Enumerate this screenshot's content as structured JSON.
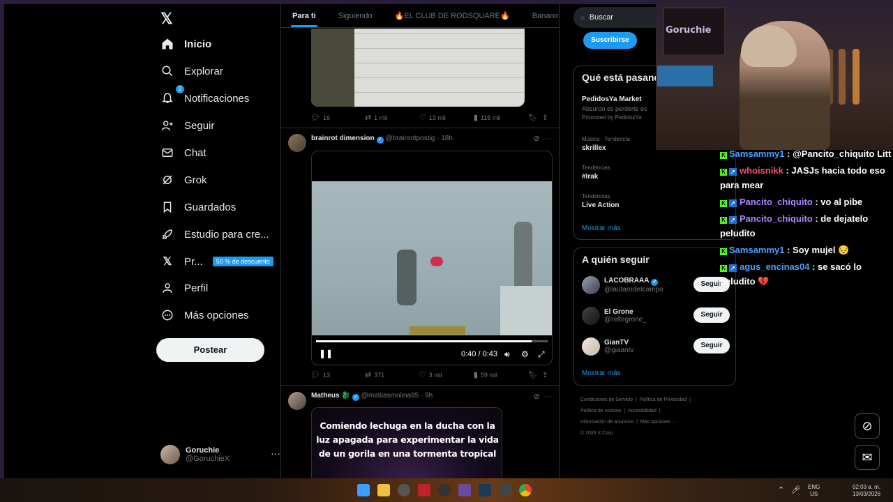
{
  "nav": {
    "items": [
      {
        "label": "Inicio",
        "icon": "home-icon"
      },
      {
        "label": "Explorar",
        "icon": "search-icon"
      },
      {
        "label": "Notificaciones",
        "icon": "bell-icon",
        "badge": "2"
      },
      {
        "label": "Seguir",
        "icon": "add-user-icon"
      },
      {
        "label": "Chat",
        "icon": "mail-icon"
      },
      {
        "label": "Grok",
        "icon": "grok-icon"
      },
      {
        "label": "Guardados",
        "icon": "bookmark-icon"
      },
      {
        "label": "Estudio para cre...",
        "icon": "rocket-icon"
      },
      {
        "label": "Pr...",
        "icon": "x-icon",
        "promo": "50 % de descuento"
      },
      {
        "label": "Perfil",
        "icon": "person-icon"
      },
      {
        "label": "Más opciones",
        "icon": "more-circle-icon"
      }
    ],
    "post_button": "Postear",
    "account": {
      "name": "Goruchie",
      "handle": "@GoruchieX",
      "more": "···"
    }
  },
  "tabs": [
    "Para ti",
    "Siguiendo",
    "🔥EL CLUB DE RODSQUARE🔥",
    "Bananirou"
  ],
  "feed": {
    "post1_actions": {
      "replies": "16",
      "reposts": "1 mil",
      "likes": "13 mil",
      "views": "115 mil"
    },
    "post2": {
      "name": "brainrot dimension",
      "handle": "@brainrotpostig",
      "time": "· 18h",
      "video": {
        "time": "0:40 / 0:43",
        "progress": 0.93
      },
      "actions": {
        "replies": "13",
        "reposts": "371",
        "likes": "3 mil",
        "views": "59 mil"
      }
    },
    "post3": {
      "name": "Matheus",
      "emoji": "🐉",
      "handle": "@matiiasmolina85",
      "time": "· 9h",
      "meme_lines": [
        "Comiendo lechuga en la ducha con la",
        "luz apagada para experimentar la vida",
        "de un gorila en una tormenta tropical"
      ]
    }
  },
  "right": {
    "search_placeholder": "Buscar",
    "subscribe": "Suscribirse",
    "trends_title": "Qué está pasand",
    "promo": {
      "title": "PedidosYa Market",
      "desc": "Absurdo es perderte es",
      "by": "Promoted by PedidosYa"
    },
    "trends": [
      {
        "cat": "Música · Tendencia",
        "title": "skrillex"
      },
      {
        "cat": "Tendencias",
        "title": "#Irak"
      },
      {
        "cat": "Tendencias",
        "title": "Live Action"
      }
    ],
    "show_more": "Mostrar más",
    "who_title": "A quién seguir",
    "who": [
      {
        "name": "LACOBRAAA",
        "handle": "@lautarodeIcampo",
        "verified": true
      },
      {
        "name": "El Grone",
        "handle": "@reltegrone_",
        "verified": false
      },
      {
        "name": "GianTV",
        "handle": "@giaantv",
        "verified": false
      }
    ],
    "follow_label": "Seguir",
    "footer": [
      "Condiciones de Servicio",
      "|",
      "Política de Privacidad",
      "|",
      "Política de cookies",
      "|",
      "Accesibilidad",
      "|",
      "Información de anuncios",
      "|",
      "Más opciones ···",
      "© 2026 X Corp."
    ]
  },
  "webcam_sign": "Goruchie",
  "chat": [
    {
      "user": "Samsammy1",
      "color": "blue",
      "badges": 1,
      "msg": ": @Pancito_chiquito Litt"
    },
    {
      "user": "whoisnikk",
      "color": "red",
      "badges": 2,
      "msg": ": JASJs hacia todo eso para mear"
    },
    {
      "user": "Pancito_chiquito",
      "color": "purple",
      "badges": 2,
      "msg": ": vo al pibe"
    },
    {
      "user": "Pancito_chiquito",
      "color": "purple",
      "badges": 2,
      "msg": ": de dejatelo peludito"
    },
    {
      "user": "Samsammy1",
      "color": "blue",
      "badges": 1,
      "msg": ": Soy mujel 😔"
    },
    {
      "user": "agus_encinas04",
      "color": "blue",
      "badges": 2,
      "msg": ": se sacó lo peludito 💔"
    }
  ],
  "taskbar": {
    "lang": [
      "ENG",
      "US"
    ],
    "time": "02:03 a. m.",
    "date": "13/03/2026"
  },
  "colors": {
    "accent": "#1d9bf0",
    "bg": "#000000",
    "kick_green": "#53fc18"
  }
}
